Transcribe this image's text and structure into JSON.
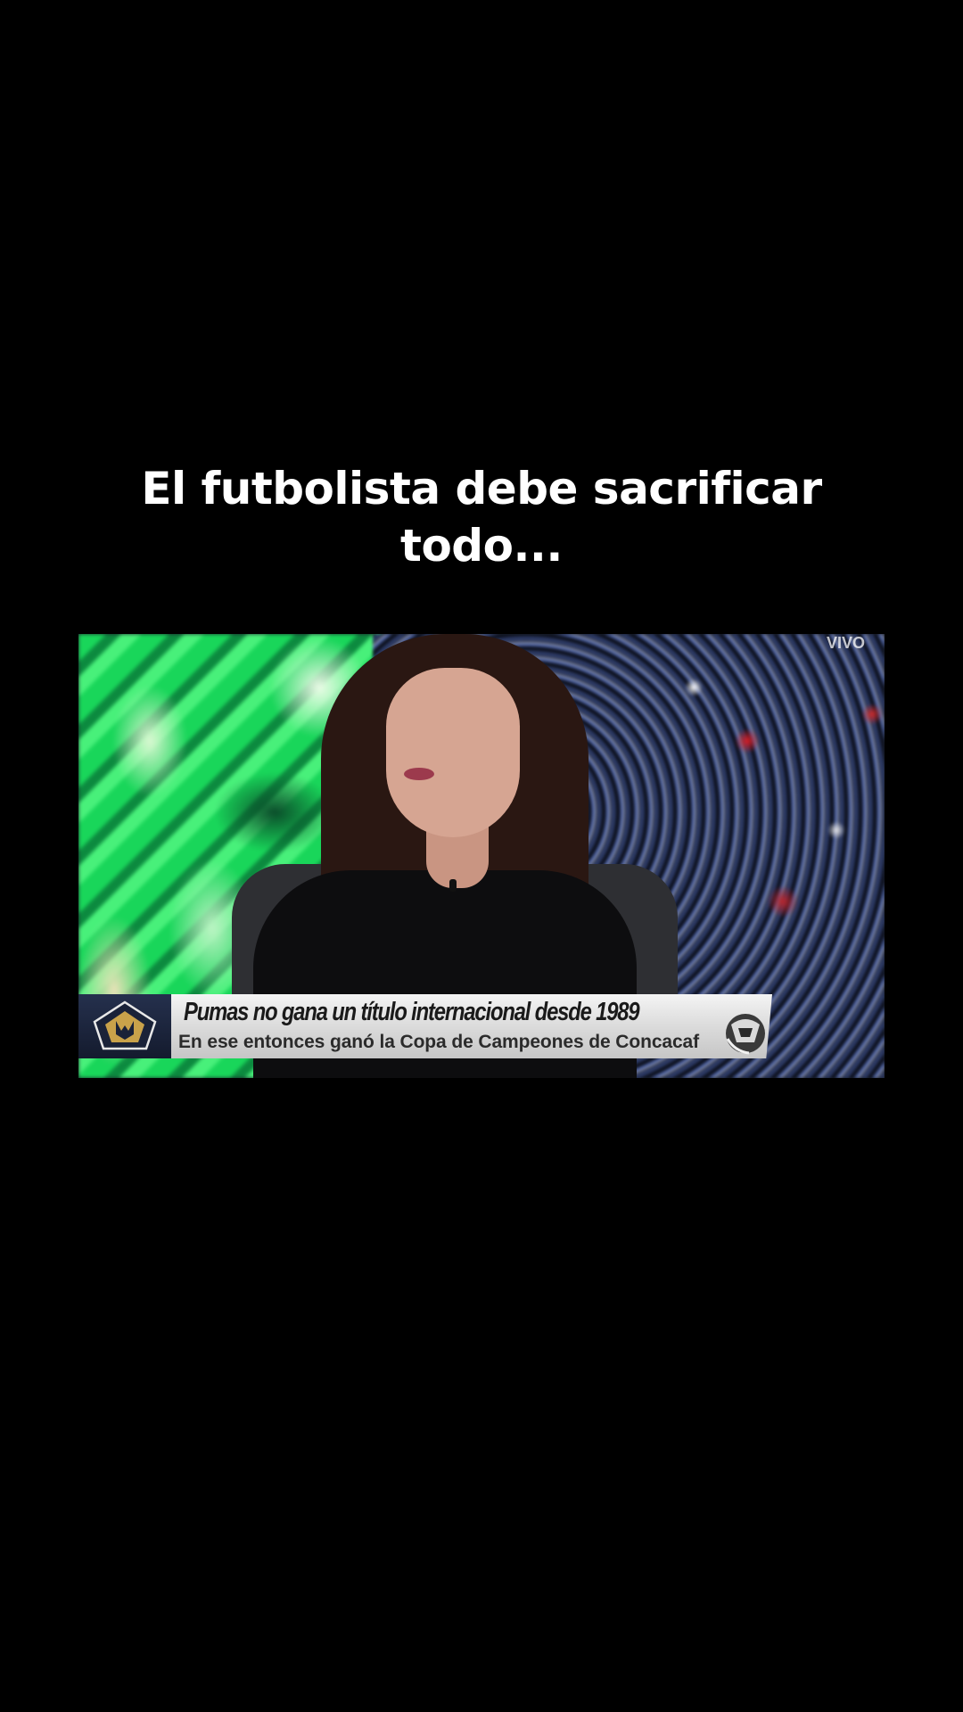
{
  "caption": {
    "text": "El futbolista debe sacrificar todo..."
  },
  "video": {
    "live_tag": "VIVO",
    "lower_third": {
      "logo_icon": "pumas-logo-icon",
      "headline": "Pumas no gana un título internacional desde 1989",
      "subline": "En ese entonces ganó la Copa de Campeones de Concacaf",
      "ball_icon": "soccer-ball-icon"
    }
  },
  "colors": {
    "background": "#000000",
    "caption_text": "#ffffff",
    "lower_third_bar": "#e0e0e0",
    "logo_box": "#1c243b",
    "logo_gold": "#c9a24a"
  }
}
